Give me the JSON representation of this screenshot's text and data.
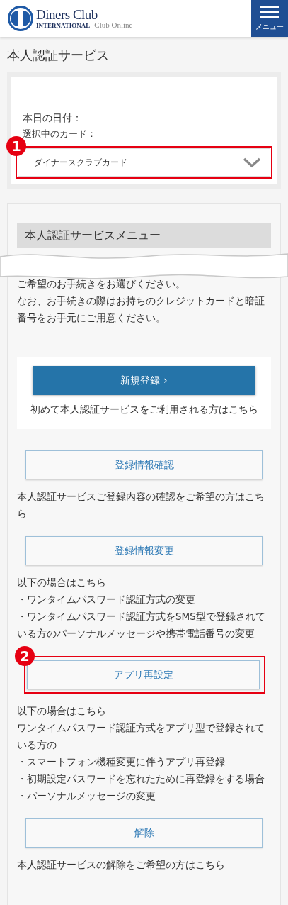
{
  "header": {
    "brand": "Diners Club",
    "brand_sub": "INTERNATIONAL",
    "service": "Club Online",
    "menu_label": "メニュー"
  },
  "page_title": "本人認証サービス",
  "card_panel": {
    "date_label": "本日の日付：",
    "card_label": "選択中のカード：",
    "card_select": {
      "value": "ダイナースクラブカード_",
      "callout": "1"
    }
  },
  "menu": {
    "heading": "本人認証サービスメニュー",
    "intro": [
      "ご希望のお手続きをお選びください。",
      "なお、お手続きの際はお持ちのクレジットカードと暗証番号をお手元にご用意ください。"
    ],
    "actions": [
      {
        "kind": "primary",
        "label": "新規登録 ›",
        "description": [
          "初めて本人認証サービスをご利用される方はこちら"
        ]
      },
      {
        "kind": "secondary",
        "label": "登録情報確認",
        "description": [
          "本人認証サービスご登録内容の確認をご希望の方はこちら"
        ]
      },
      {
        "kind": "secondary",
        "label": "登録情報変更",
        "description": [
          "以下の場合はこちら",
          "・ワンタイムパスワード認証方式の変更",
          "・ワンタイムパスワード認証方式をSMS型で登録されている方のパーソナルメッセージや携帯電話番号の変更"
        ]
      },
      {
        "kind": "secondary",
        "label": "アプリ再設定",
        "callout": "2",
        "description": [
          "以下の場合はこちら",
          "ワンタイムパスワード認証方式をアプリ型で登録されている方の",
          "・スマートフォン機種変更に伴うアプリ再登録",
          "・初期設定パスワードを忘れたために再登録をする場合",
          "・パーソナルメッセージの変更"
        ]
      },
      {
        "kind": "secondary",
        "label": "解除",
        "description": [
          "本人認証サービスの解除をご希望の方はこちら"
        ]
      }
    ]
  }
}
